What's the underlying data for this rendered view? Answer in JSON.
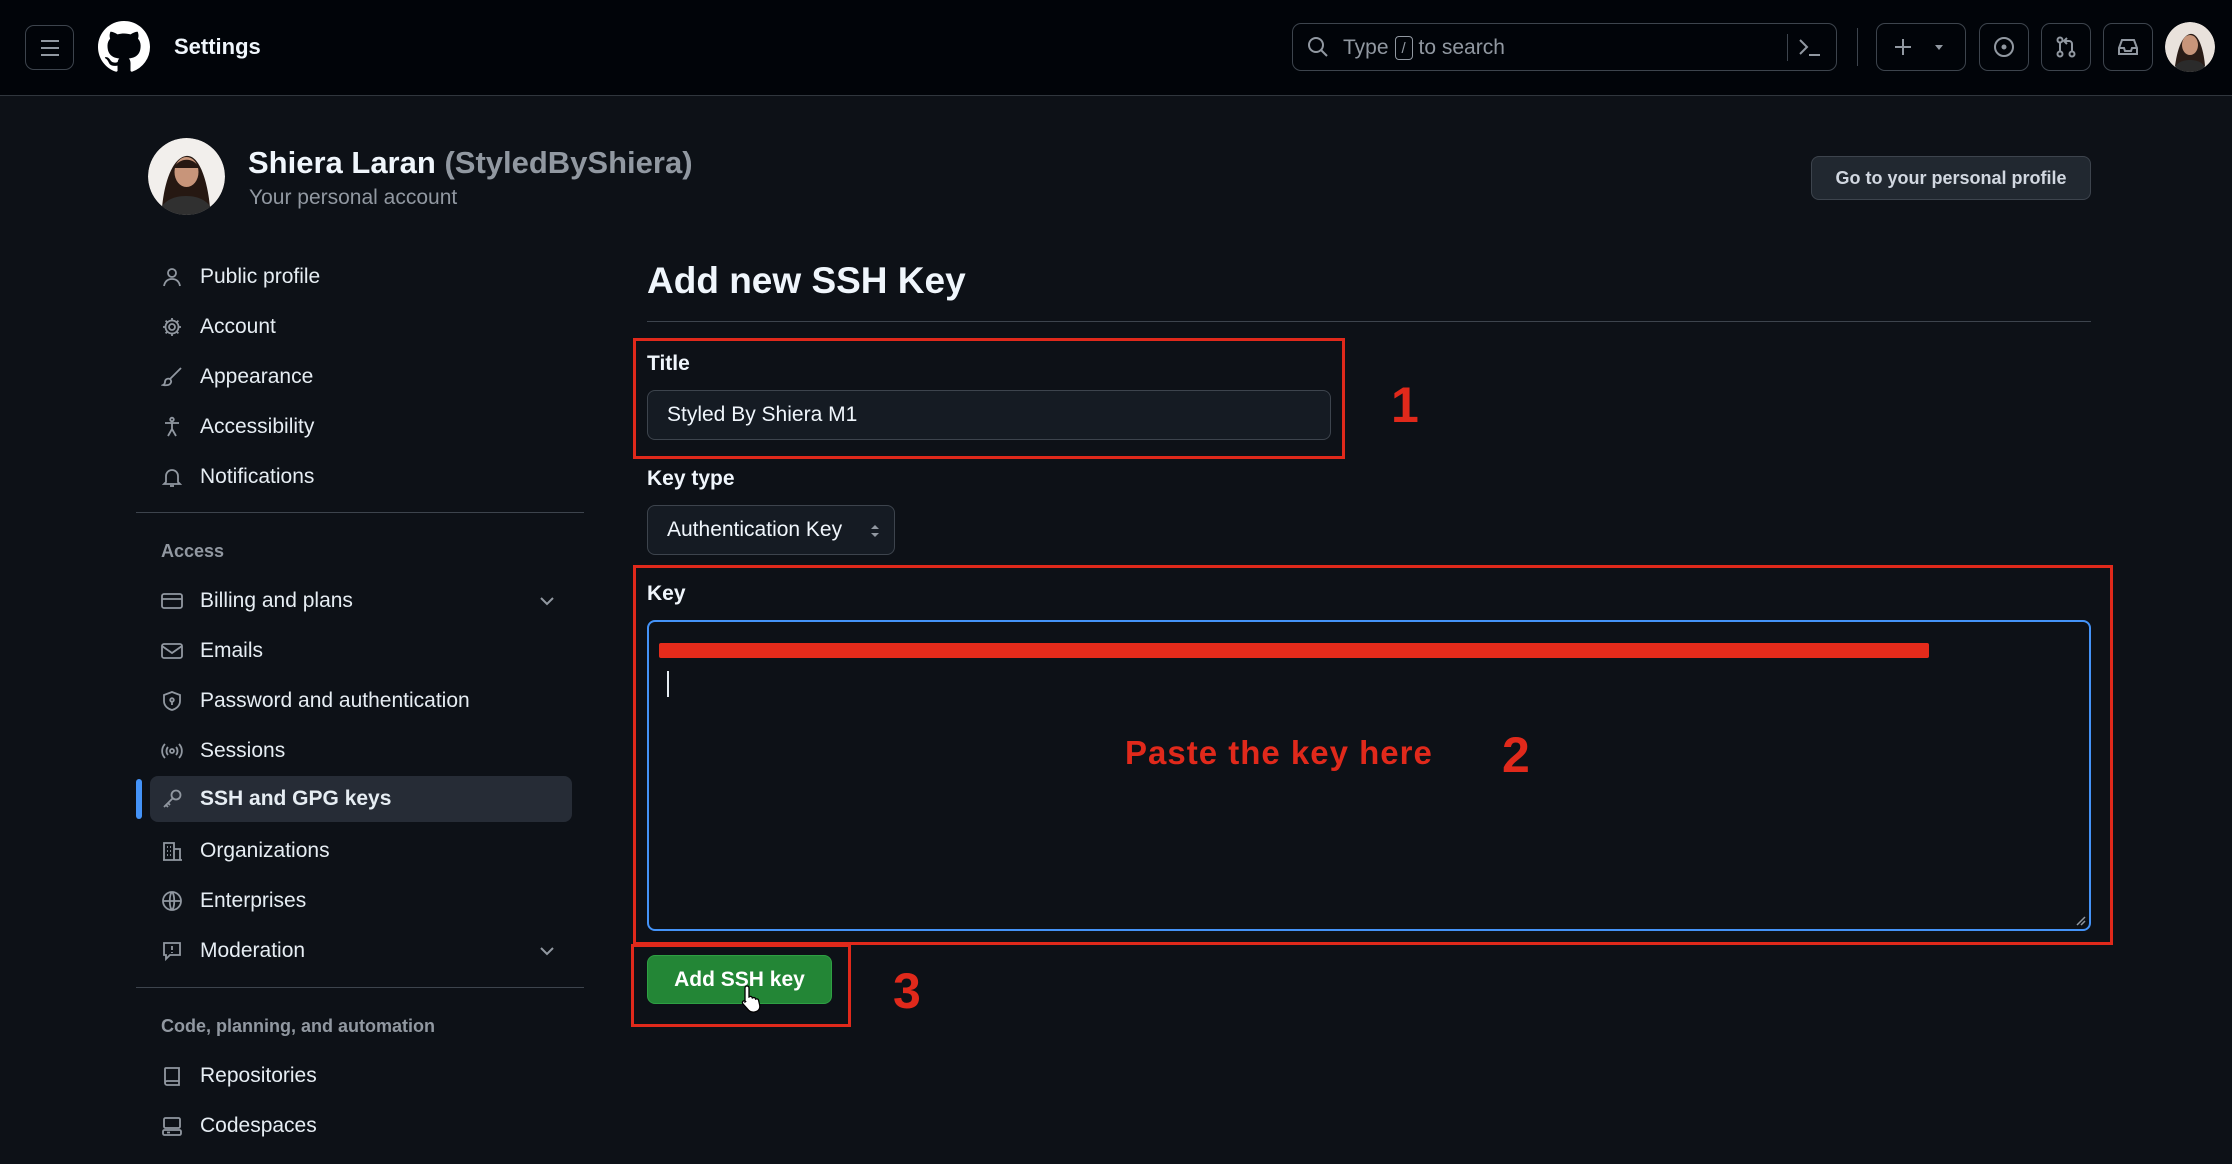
{
  "header": {
    "title": "Settings",
    "search": {
      "prefix": "Type",
      "key": "/",
      "suffix": "to search"
    }
  },
  "profile": {
    "name": "Shiera Laran",
    "handle": "(StyledByShiera)",
    "subtitle": "Your personal account",
    "profile_button": "Go to your personal profile"
  },
  "sidebar": {
    "items": [
      {
        "label": "Public profile",
        "icon": "person-icon"
      },
      {
        "label": "Account",
        "icon": "gear-icon"
      },
      {
        "label": "Appearance",
        "icon": "paintbrush-icon"
      },
      {
        "label": "Accessibility",
        "icon": "accessibility-icon"
      },
      {
        "label": "Notifications",
        "icon": "bell-icon"
      }
    ],
    "access_heading": "Access",
    "access_items": [
      {
        "label": "Billing and plans",
        "icon": "credit-card-icon"
      },
      {
        "label": "Emails",
        "icon": "mail-icon"
      },
      {
        "label": "Password and authentication",
        "icon": "shield-icon"
      },
      {
        "label": "Sessions",
        "icon": "broadcast-icon"
      },
      {
        "label": "SSH and GPG keys",
        "icon": "key-icon",
        "active": true
      },
      {
        "label": "Organizations",
        "icon": "organization-icon"
      },
      {
        "label": "Enterprises",
        "icon": "globe-icon"
      },
      {
        "label": "Moderation",
        "icon": "report-icon"
      }
    ],
    "code_heading": "Code, planning, and automation",
    "code_items": [
      {
        "label": "Repositories",
        "icon": "repo-icon"
      },
      {
        "label": "Codespaces",
        "icon": "codespaces-icon"
      }
    ]
  },
  "form": {
    "heading": "Add new SSH Key",
    "title_label": "Title",
    "title_value": "Styled By Shiera M1",
    "key_type_label": "Key type",
    "key_type_value": "Authentication Key",
    "key_label": "Key",
    "submit_label": "Add SSH key"
  },
  "annotations": {
    "num1": "1",
    "num2": "2",
    "num3": "3",
    "paste_hint": "Paste the key here",
    "color": "#e0291b"
  },
  "colors": {
    "accent_blue": "#4493f8",
    "button_green": "#238636",
    "background": "#0d1117"
  }
}
